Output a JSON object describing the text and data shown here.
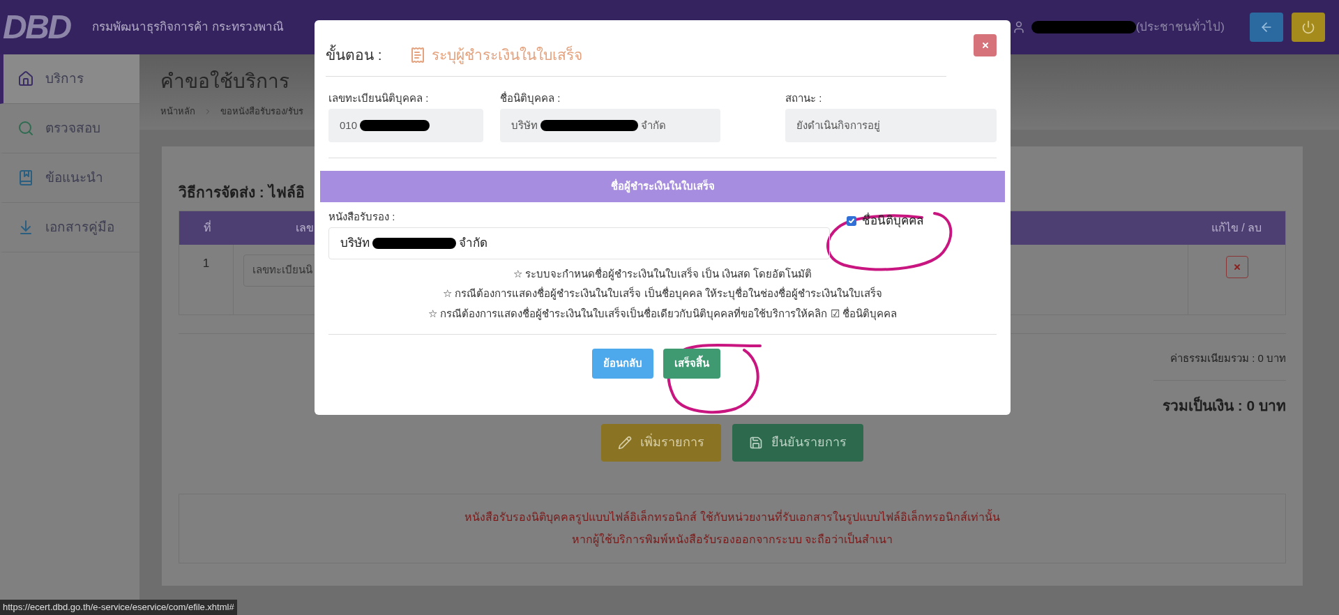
{
  "header": {
    "logo": "DBD",
    "org_name": "กรมพัฒนาธุรกิจการค้า กระทรวงพาณิ",
    "user_role": "(ประชาชนทั่วไป)"
  },
  "sidebar": {
    "items": [
      {
        "label": "บริการ",
        "selected": true
      },
      {
        "label": "ตรวจสอบ",
        "selected": false
      },
      {
        "label": "ข้อแนะนำ",
        "selected": false
      },
      {
        "label": "เอกสารคู่มือ",
        "selected": false
      }
    ]
  },
  "page": {
    "title": "คำขอใช้บริการ",
    "breadcrumb": [
      "หน้าหลัก",
      "ขอหนังสือรับรอง/รับร"
    ]
  },
  "card": {
    "title": "วิธีการจัดส่ง : ไฟล์อิ",
    "table": {
      "columns": [
        "ที่",
        "เลข",
        "แก้ไข / ลบ"
      ],
      "rows": [
        {
          "number": "1",
          "value": "เลขทะเบียนนิ"
        }
      ]
    },
    "fee": "ค่าธรรมเนียมรวม : 0 บาท",
    "total": "รวมเป็นเงิน : 0 บาท",
    "buttons": [
      {
        "label": "เพิ่มรายการ",
        "kind": "add"
      },
      {
        "label": "ยืนยันรายการ",
        "kind": "confirm"
      }
    ],
    "notice": [
      "หนังสือรับรองนิติบุคคลรูปแบบไฟล์อิเล็กทรอนิกส์ ใช้กับหน่วยงานที่รับเอกสารในรูปแบบไฟล์อิเล็กทรอนิกส์เท่านั้น",
      "หากผู้ใช้บริการพิมพ์หนังสือรับรองออกจากระบบ จะถือว่าเป็นสำเนา"
    ]
  },
  "modal": {
    "step_label": "ขั้นตอน :",
    "step_title": "ระบุผู้ชำระเงินในใบเสร็จ",
    "fields": [
      {
        "label": "เลขทะเบียนนิติบุคคล :",
        "value_parts": [
          "010"
        ],
        "redacted": true
      },
      {
        "label": "ชื่อนิติบุคคล :",
        "value_parts": [
          "บริษัท",
          "จำกัด"
        ]
      },
      {
        "label": "สถานะ :",
        "value_parts": [
          "ยังดำเนินกิจการอยู่"
        ],
        "redacted": false
      }
    ],
    "section_title": "ชื่อผู้ชำระเงินในใบเสร็จ",
    "certificate": {
      "label": "หนังสือรับรอง :",
      "value_parts": [
        "บริษัท",
        "จำกัด"
      ]
    },
    "checkbox": {
      "label": "ชื่อนิติบุคคล",
      "checked": true
    },
    "notes": [
      "☆ ระบบจะกำหนดชื่อผู้ชำระเงินในใบเสร็จ เป็น เงินสด โดยอัตโนมัติ",
      "☆ กรณีต้องการแสดงชื่อผู้ชำระเงินในใบเสร็จ เป็นชื่อบุคคล ให้ระบุชื่อในช่องชื่อผู้ชำระเงินในใบเสร็จ",
      "☆ กรณีต้องการแสดงชื่อผู้ชำระเงินในใบเสร็จเป็นชื่อเดียวกับนิติบุคคลที่ขอใช้บริการให้คลิก ☑ ชื่อนิติบุคคล"
    ],
    "buttons": [
      {
        "label": "ย้อนกลับ",
        "kind": "back"
      },
      {
        "label": "เสร็จสิ้น",
        "kind": "finish"
      }
    ]
  },
  "status_bar": "https://ecert.dbd.go.th/e-service/eservice/com/efile.xhtml#"
}
